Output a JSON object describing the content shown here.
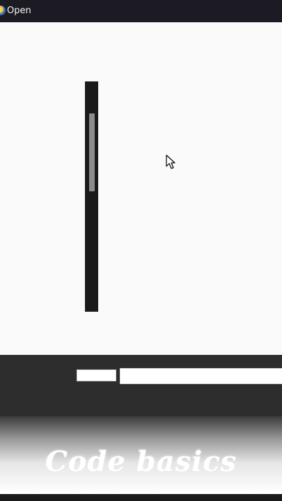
{
  "window": {
    "title": "Open",
    "icon": "python-icon"
  },
  "footer": {
    "file_type_value": "",
    "filename_value": "",
    "filename_placeholder": ""
  },
  "overlay": {
    "watermark_text": "Code basics"
  },
  "colors": {
    "titlebar": "#1c1a22",
    "dialog_background": "#fafafa",
    "scrollbar_track": "#1a1a1a",
    "scrollbar_thumb": "#8c8c8c",
    "footer_background": "#2d2d2d"
  }
}
